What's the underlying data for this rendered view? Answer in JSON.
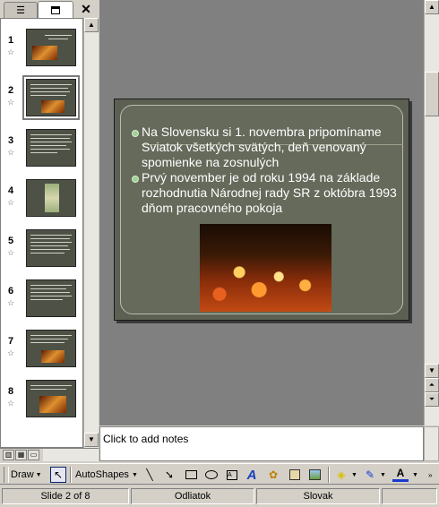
{
  "left_panel": {
    "tabs": [
      {
        "name": "outline-tab",
        "icon": "outline-icon"
      },
      {
        "name": "slides-tab",
        "icon": "slides-icon"
      }
    ],
    "close_label": "✕",
    "slides": [
      {
        "number": "1",
        "star": "☆"
      },
      {
        "number": "2",
        "star": "☆"
      },
      {
        "number": "3",
        "star": "☆"
      },
      {
        "number": "4",
        "star": "☆"
      },
      {
        "number": "5",
        "star": "☆"
      },
      {
        "number": "6",
        "star": "☆"
      },
      {
        "number": "7",
        "star": "☆"
      },
      {
        "number": "8",
        "star": "☆"
      }
    ],
    "active_slide": 2
  },
  "slide": {
    "bullets": [
      "Na Slovensku si 1. novembra pripomíname Sviatok všetkých svätých, deň venovaný spomienke na zosnulých",
      "Prvý november je od roku 1994 na základe rozhodnutia Národnej rady SR z októbra 1993 dňom pracovného pokoja"
    ],
    "colors": {
      "background": "#5c6052",
      "text": "#ffffff",
      "bullet": "#9fd09a"
    }
  },
  "notes": {
    "placeholder": "Click to add notes"
  },
  "drawing_toolbar": {
    "draw_label": "Draw",
    "autoshapes_label": "AutoShapes",
    "icons": [
      "select-pointer-icon",
      "line-icon",
      "arrow-icon",
      "rectangle-icon",
      "oval-icon",
      "textbox-icon",
      "wordart-icon",
      "diagram-icon",
      "clipart-icon",
      "picture-icon",
      "fill-color-icon",
      "line-color-icon",
      "font-color-icon"
    ]
  },
  "statusbar": {
    "slide_info": "Slide 2 of 8",
    "design": "Odliatok",
    "language": "Slovak"
  }
}
